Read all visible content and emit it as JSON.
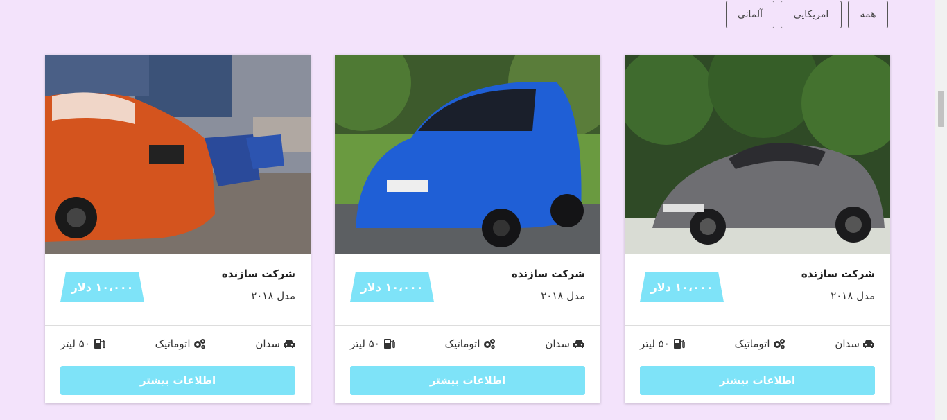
{
  "filters": [
    {
      "label": "همه"
    },
    {
      "label": "امریکایی"
    },
    {
      "label": "آلمانی"
    }
  ],
  "cars": [
    {
      "title": "شرکت سازنده",
      "model": "مدل ۲۰۱۸",
      "price": "۱۰،۰۰۰ دلار",
      "body": "سدان",
      "transmission": "اتوماتیک",
      "fuel": "۵۰ لیتر",
      "button": "اطلاعات بیشتر",
      "photo_color": "#6e6e72"
    },
    {
      "title": "شرکت سازنده",
      "model": "مدل ۲۰۱۸",
      "price": "۱۰،۰۰۰ دلار",
      "body": "سدان",
      "transmission": "اتوماتیک",
      "fuel": "۵۰ لیتر",
      "button": "اطلاعات بیشتر",
      "photo_color": "#1f5fd6"
    },
    {
      "title": "شرکت سازنده",
      "model": "مدل ۲۰۱۸",
      "price": "۱۰،۰۰۰ دلار",
      "body": "سدان",
      "transmission": "اتوماتیک",
      "fuel": "۵۰ لیتر",
      "button": "اطلاعات بیشتر",
      "photo_color": "#d4541e"
    }
  ],
  "colors": {
    "background": "#f3e3fb",
    "accent": "#7ee3f8"
  }
}
